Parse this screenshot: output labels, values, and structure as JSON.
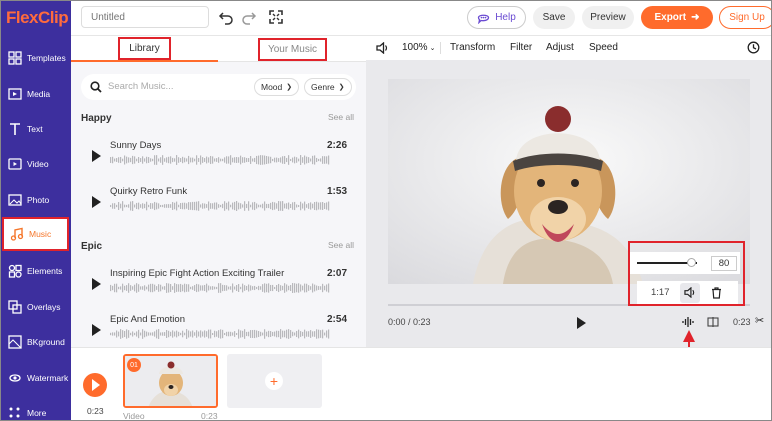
{
  "app": {
    "logo": "FlexClip"
  },
  "sidebar": {
    "items": [
      {
        "label": "Templates",
        "icon": "templates-icon"
      },
      {
        "label": "Media",
        "icon": "media-icon"
      },
      {
        "label": "Text",
        "icon": "text-icon"
      },
      {
        "label": "Video",
        "icon": "video-icon"
      },
      {
        "label": "Photo",
        "icon": "photo-icon"
      },
      {
        "label": "Music",
        "icon": "music-icon",
        "active": true
      },
      {
        "label": "Elements",
        "icon": "elements-icon"
      },
      {
        "label": "Overlays",
        "icon": "overlays-icon"
      },
      {
        "label": "BKground",
        "icon": "background-icon"
      },
      {
        "label": "Watermark",
        "icon": "watermark-icon"
      },
      {
        "label": "More",
        "icon": "more-icon"
      }
    ]
  },
  "topbar": {
    "title_placeholder": "Untitled",
    "help": "Help",
    "save": "Save",
    "preview": "Preview",
    "export": "Export",
    "signup": "Sign Up"
  },
  "music_panel": {
    "tabs": [
      "Library",
      "Your Music"
    ],
    "search_placeholder": "Search Music...",
    "mood": "Mood",
    "genre": "Genre",
    "sections": [
      {
        "title": "Happy",
        "see_all": "See all",
        "tracks": [
          {
            "name": "Sunny Days",
            "duration": "2:26"
          },
          {
            "name": "Quirky Retro Funk",
            "duration": "1:53"
          }
        ]
      },
      {
        "title": "Epic",
        "see_all": "See all",
        "tracks": [
          {
            "name": "Inspiring Epic Fight Action Exciting Trailer",
            "duration": "2:07"
          },
          {
            "name": "Epic And Emotion",
            "duration": "2:54"
          }
        ]
      }
    ]
  },
  "video_toolbar": {
    "zoom": "100%",
    "transform": "Transform",
    "filter": "Filter",
    "adjust": "Adjust",
    "speed": "Speed"
  },
  "player": {
    "current": "0:00 / 0:23",
    "end": "0:23",
    "volume_value": "80",
    "volume_level": 0.8,
    "music_time": "1:17"
  },
  "timeline": {
    "total": "0:23",
    "clip_number": "01",
    "clip_label": "Video",
    "clip_duration": "0:23",
    "add": "+"
  },
  "colors": {
    "accent": "#ff6b2c",
    "rail": "#3d2f9e",
    "highlight": "#e0232b"
  }
}
